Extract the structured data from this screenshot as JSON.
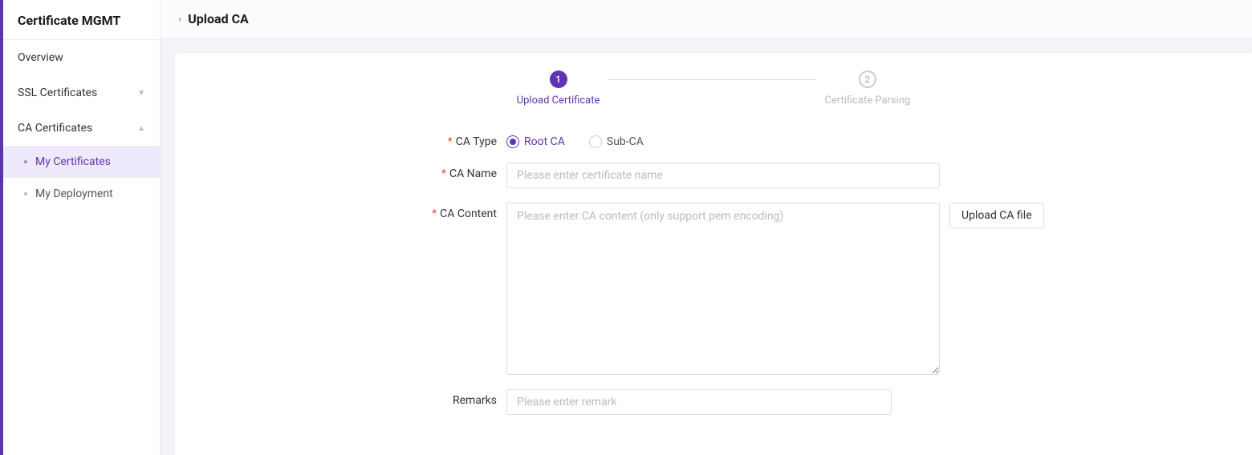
{
  "sidebar": {
    "title": "Certificate MGMT",
    "items": [
      {
        "label": "Overview",
        "expandable": false
      },
      {
        "label": "SSL Certificates",
        "expandable": true,
        "expanded": false
      },
      {
        "label": "CA Certificates",
        "expandable": true,
        "expanded": true
      }
    ],
    "ca_sub_items": [
      {
        "label": "My Certificates",
        "active": true
      },
      {
        "label": "My Deployment",
        "active": false
      }
    ]
  },
  "header": {
    "title": "Upload CA"
  },
  "stepper": {
    "step1": {
      "number": "1",
      "label": "Upload Certificate"
    },
    "step2": {
      "number": "2",
      "label": "Certificate Parsing"
    }
  },
  "form": {
    "ca_type": {
      "label": "CA Type",
      "options": [
        {
          "label": "Root CA",
          "selected": true
        },
        {
          "label": "Sub-CA",
          "selected": false
        }
      ]
    },
    "ca_name": {
      "label": "CA Name",
      "placeholder": "Please enter certificate name",
      "value": ""
    },
    "ca_content": {
      "label": "CA Content",
      "placeholder": "Please enter CA content (only support pem encoding)",
      "value": "",
      "upload_button": "Upload CA file"
    },
    "remarks": {
      "label": "Remarks",
      "placeholder": "Please enter remark",
      "value": ""
    }
  }
}
